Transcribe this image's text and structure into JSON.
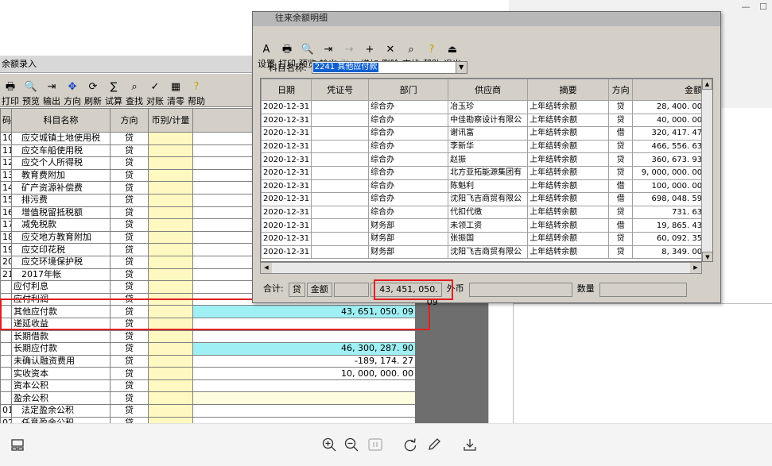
{
  "window_controls": {
    "minimize": "—",
    "maximize": "☐"
  },
  "bg_window": {
    "title": "余额录入",
    "toolbar": [
      {
        "label": "打印",
        "icon": "print-icon"
      },
      {
        "label": "预览",
        "icon": "preview-icon"
      },
      {
        "label": "输出",
        "icon": "export-icon"
      },
      {
        "label": "方向",
        "icon": "direction-icon"
      },
      {
        "label": "刷新",
        "icon": "refresh-icon"
      },
      {
        "label": "试算",
        "icon": "calc-icon"
      },
      {
        "label": "查找",
        "icon": "find-icon"
      },
      {
        "label": "对账",
        "icon": "reconcile-icon"
      },
      {
        "label": "清零",
        "icon": "clear-icon"
      },
      {
        "label": "帮助",
        "icon": "help-icon"
      }
    ],
    "columns": {
      "code": "码",
      "name": "科目名称",
      "dir": "方向",
      "currency": "币别/计量",
      "amount": ""
    },
    "rows": [
      {
        "code": "10",
        "name": "应交城镇土地使用税",
        "dir": "贷",
        "amount": "",
        "style": "",
        "indent": true
      },
      {
        "code": "11",
        "name": "应交车船使用税",
        "dir": "贷",
        "amount": "",
        "style": "",
        "indent": true
      },
      {
        "code": "12",
        "name": "应交个人所得税",
        "dir": "贷",
        "amount": "",
        "style": "",
        "indent": true
      },
      {
        "code": "13",
        "name": "教育费附加",
        "dir": "贷",
        "amount": "",
        "style": "",
        "indent": true
      },
      {
        "code": "14",
        "name": "矿产资源补偿费",
        "dir": "贷",
        "amount": "",
        "style": "",
        "indent": true
      },
      {
        "code": "15",
        "name": "排污费",
        "dir": "贷",
        "amount": "",
        "style": "",
        "indent": true
      },
      {
        "code": "16",
        "name": "增值税留抵税额",
        "dir": "贷",
        "amount": "",
        "style": "",
        "indent": true
      },
      {
        "code": "17",
        "name": "减免税款",
        "dir": "贷",
        "amount": "",
        "style": "",
        "indent": true
      },
      {
        "code": "18",
        "name": "应交地方教育附加",
        "dir": "贷",
        "amount": "",
        "style": "",
        "indent": true
      },
      {
        "code": "19",
        "name": "应交印花税",
        "dir": "贷",
        "amount": "",
        "style": "",
        "indent": true
      },
      {
        "code": "20",
        "name": "应交环境保护税",
        "dir": "贷",
        "amount": "",
        "style": "",
        "indent": true
      },
      {
        "code": "21",
        "name": "2017年帐",
        "dir": "贷",
        "amount": "",
        "style": "",
        "indent": true
      },
      {
        "code": "",
        "name": "应付利息",
        "dir": "贷",
        "amount": "",
        "style": "",
        "indent": false
      },
      {
        "code": "",
        "name": "应付利润",
        "dir": "贷",
        "amount": "",
        "style": "",
        "indent": false
      },
      {
        "code": "",
        "name": "其他应付款",
        "dir": "贷",
        "amount": "43, 651, 050. 09",
        "style": "cyan",
        "indent": false
      },
      {
        "code": "",
        "name": "递延收益",
        "dir": "贷",
        "amount": "",
        "style": "",
        "indent": false
      },
      {
        "code": "",
        "name": "长期借款",
        "dir": "贷",
        "amount": "",
        "style": "",
        "indent": false
      },
      {
        "code": "",
        "name": "长期应付款",
        "dir": "贷",
        "amount": "46, 300, 287. 90",
        "style": "cyan",
        "indent": false
      },
      {
        "code": "",
        "name": "未确认融资费用",
        "dir": "贷",
        "amount": "-189, 174. 27",
        "style": "",
        "indent": false
      },
      {
        "code": "",
        "name": "实收资本",
        "dir": "贷",
        "amount": "10, 000, 000. 00",
        "style": "",
        "indent": false
      },
      {
        "code": "",
        "name": "资本公积",
        "dir": "贷",
        "amount": "",
        "style": "",
        "indent": false
      },
      {
        "code": "",
        "name": "盈余公积",
        "dir": "贷",
        "amount": "",
        "style": "yellow",
        "indent": false
      },
      {
        "code": "01",
        "name": "法定盈余公积",
        "dir": "贷",
        "amount": "",
        "style": "",
        "indent": true
      },
      {
        "code": "02",
        "name": "任意盈余公积",
        "dir": "贷",
        "amount": "",
        "style": "",
        "indent": true
      }
    ]
  },
  "fg_window": {
    "title": "往来余额明细",
    "toolbar": [
      {
        "label": "设置",
        "icon": "settings-icon"
      },
      {
        "label": "打印",
        "icon": "print-icon"
      },
      {
        "label": "预览",
        "icon": "preview-icon"
      },
      {
        "label": "输出",
        "icon": "export-icon"
      },
      {
        "label": "引入",
        "icon": "import-icon"
      },
      {
        "label": "增加",
        "icon": "add-icon"
      },
      {
        "label": "删除",
        "icon": "delete-icon"
      },
      {
        "label": "查找",
        "icon": "find-icon"
      },
      {
        "label": "帮助",
        "icon": "help-icon"
      },
      {
        "label": "退出",
        "icon": "exit-icon"
      }
    ],
    "subject_label": "科目名称:",
    "subject_value": "2241 其他应付款",
    "columns": [
      "日期",
      "凭证号",
      "部门",
      "供应商",
      "摘要",
      "方向",
      "金额"
    ],
    "rows": [
      [
        "2020-12-31",
        "",
        "综合办",
        "冶玉珍",
        "上年结转余额",
        "贷",
        "28, 400. 00"
      ],
      [
        "2020-12-31",
        "",
        "综合办",
        "中佳勘察设计有限公",
        "上年结转余额",
        "贷",
        "40, 000. 00"
      ],
      [
        "2020-12-31",
        "",
        "综合办",
        "谢讯富",
        "上年结转余额",
        "借",
        "320, 417. 47"
      ],
      [
        "2020-12-31",
        "",
        "综合办",
        "李新华",
        "上年结转余额",
        "贷",
        "466, 556. 63"
      ],
      [
        "2020-12-31",
        "",
        "综合办",
        "赵振",
        "上年结转余额",
        "贷",
        "360, 673. 93"
      ],
      [
        "2020-12-31",
        "",
        "综合办",
        "北方亚拓能源集团有",
        "上年结转余额",
        "贷",
        "9, 000, 000. 00"
      ],
      [
        "2020-12-31",
        "",
        "综合办",
        "陈魁利",
        "上年结转余额",
        "借",
        "100, 000. 00"
      ],
      [
        "2020-12-31",
        "",
        "综合办",
        "沈阳飞吉商贸有限公",
        "上年结转余额",
        "借",
        "698, 048. 59"
      ],
      [
        "2020-12-31",
        "",
        "综合办",
        "代扣代缴",
        "上年结转余额",
        "贷",
        "731. 63"
      ],
      [
        "2020-12-31",
        "",
        "财务部",
        "未领工资",
        "上年结转余额",
        "借",
        "19, 865. 43"
      ],
      [
        "2020-12-31",
        "",
        "财务部",
        "张振国",
        "上年结转余额",
        "贷",
        "60, 092. 35"
      ],
      [
        "2020-12-31",
        "",
        "财务部",
        "沈阳飞吉商贸有限公",
        "上年结转余额",
        "贷",
        "8, 349. 00"
      ]
    ],
    "status": {
      "total_label": "合计:",
      "dir": "贷",
      "amount_label": "金额",
      "amount": "43, 451, 050. 09",
      "foreign_label": "外币",
      "foreign_value": "",
      "qty_label": "数量",
      "qty_value": ""
    }
  },
  "highlight_color": "#e02020"
}
